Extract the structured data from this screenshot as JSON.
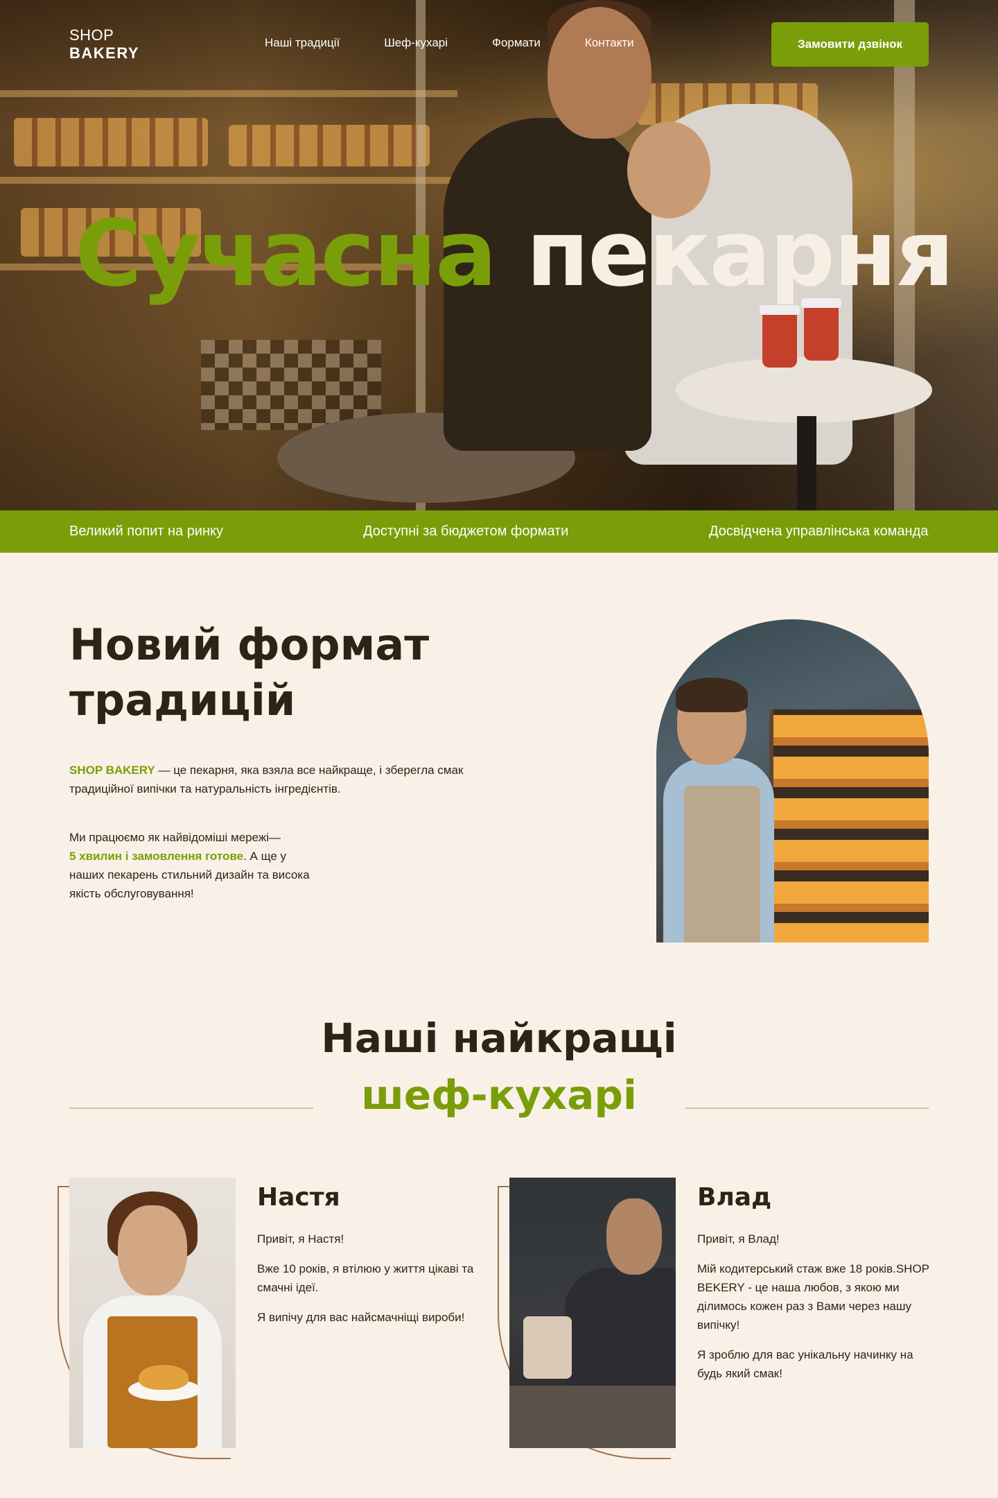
{
  "logo": {
    "line1": "SHOP",
    "line2": "BAKERY"
  },
  "nav": [
    "Наші традиції",
    "Шеф-кухарі",
    "Формати",
    "Контакти"
  ],
  "cta_label": "Замовити дзвінок",
  "hero": {
    "title_green": "Сучасна",
    "title_white": "пекарня"
  },
  "features": [
    "Великий попит на ринку",
    "Доступні за бюджетом формати",
    "Досвідчена управлінська команда"
  ],
  "about": {
    "title_line1": "Новий формат",
    "title_line2": "традицій",
    "p1_brand": "SHOP BAKERY",
    "p1_rest": " — це пекарня, яка взяла все найкраще, і зберегла смак",
    "p1_line2": "традиційної випічки та натуральність інгредієнтів.",
    "p2_line1": "Ми працюємо як найвідоміші мережі—",
    "p2_highlight": "5 хвилин і замовлення готове",
    "p2_after": ". А ще у",
    "p2_line3": "наших пекарень стильний дизайн та висока",
    "p2_line4": "якість обслуговування!"
  },
  "chefs_section": {
    "title_line1": "Наші найкращі",
    "title_line2": "шеф-кухарі"
  },
  "chefs": [
    {
      "name": "Настя",
      "p1": "Привіт, я Настя!",
      "p2": "Вже 10 років, я втілюю у життя цікаві та смачні ідеї.",
      "p3": "Я випічу для вас найсмачніщі вироби!"
    },
    {
      "name": "Влад",
      "p1": "Привіт, я Влад!",
      "p2": "Мій кодитерський стаж вже 18 років.SHOP BEKERY - це наша любов, з якою ми ділимось кожен раз з Вами через нашу випічку!",
      "p3": "Я зроблю для вас унікальну начинку на будь який смак!"
    }
  ],
  "colors": {
    "accent": "#7a9e09",
    "dark": "#2e2315",
    "background": "#f9f1e7",
    "arc": "#a0714c"
  }
}
